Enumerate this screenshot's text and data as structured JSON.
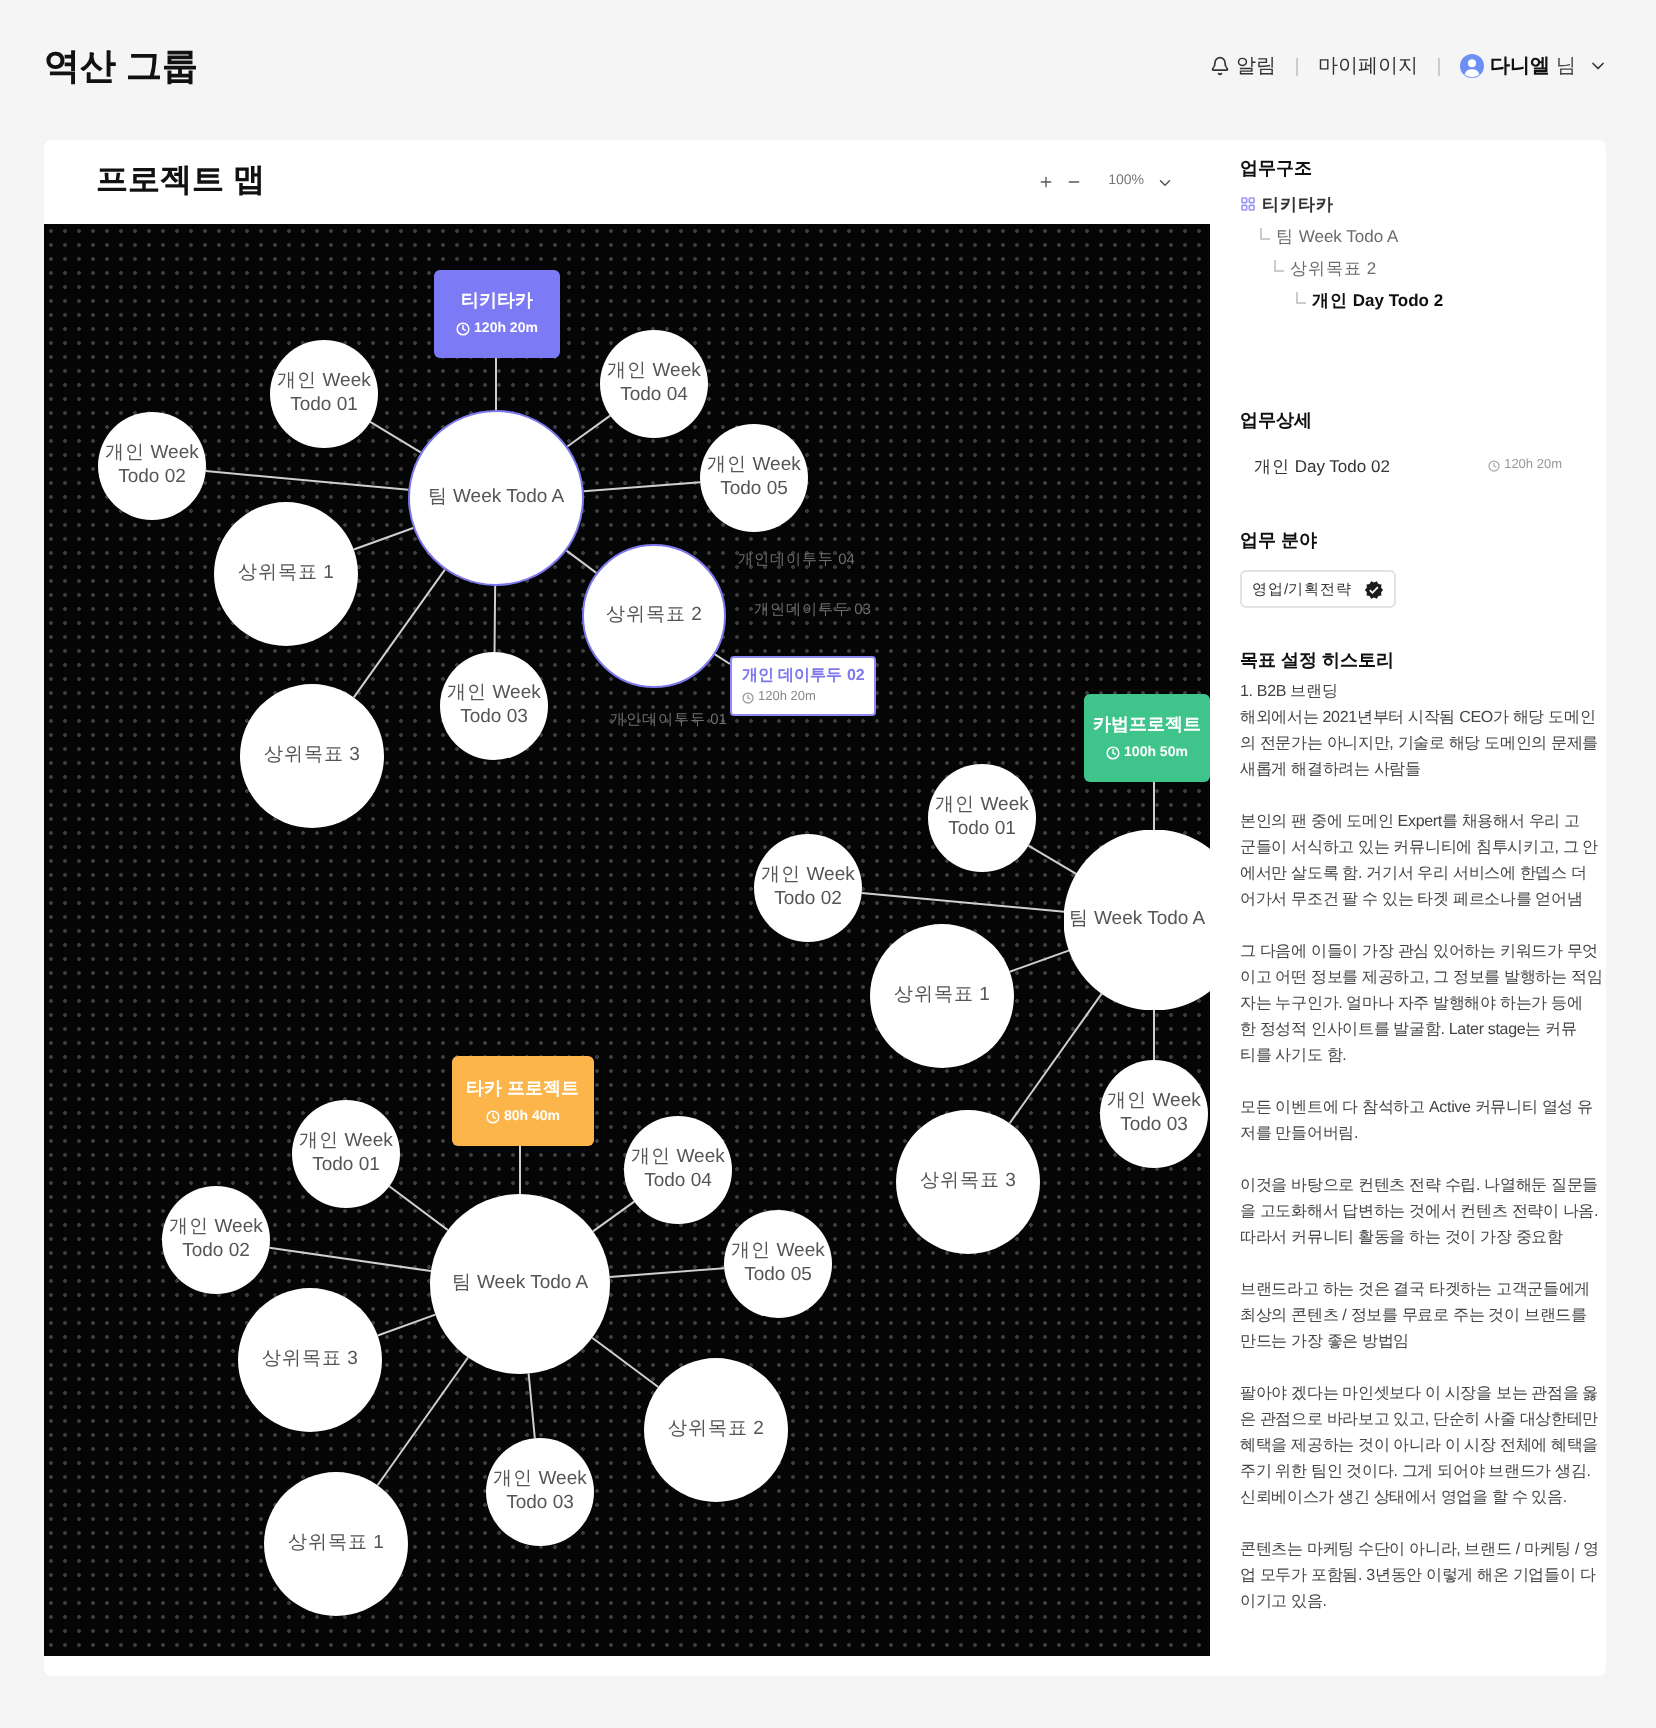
{
  "header": {
    "title": "역산 그룹",
    "notifications": "알림",
    "mypage": "마이페이지",
    "user": {
      "name": "다니엘",
      "suffix": "님"
    }
  },
  "map": {
    "title": "프로젝트 맵",
    "zoom": "100%",
    "projects": [
      {
        "name": "티키타카",
        "time": "120h 20m",
        "color": "#7d7af6",
        "team": {
          "label": "팀 Week Todo A",
          "selected": true
        },
        "nodes": [
          {
            "kind": "week",
            "label": "개인 Week Todo 01",
            "selected": false
          },
          {
            "kind": "week",
            "label": "개인 Week Todo 02",
            "selected": false
          },
          {
            "kind": "week",
            "label": "개인 Week Todo 03",
            "selected": false
          },
          {
            "kind": "week",
            "label": "개인 Week Todo 04",
            "selected": false
          },
          {
            "kind": "week",
            "label": "개인 Week Todo 05",
            "selected": false
          },
          {
            "kind": "goal",
            "label": "상위목표 1",
            "selected": false
          },
          {
            "kind": "goal",
            "label": "상위목표 2",
            "selected": true,
            "children": [
              {
                "label": "개인데이투두 04",
                "selected": false
              },
              {
                "label": "개인데이투두 03",
                "selected": false
              },
              {
                "label": "개인 데이투두 02",
                "time": "120h 20m",
                "selected": true
              },
              {
                "label": "개인데이투두 01",
                "selected": false
              }
            ]
          },
          {
            "kind": "goal",
            "label": "상위목표 3",
            "selected": false
          }
        ]
      },
      {
        "name": "카법프로젝트",
        "time": "100h 50m",
        "color": "#3fc48c",
        "team": {
          "label": "팀 Week Todo A",
          "selected": false
        },
        "nodes": [
          {
            "kind": "week",
            "label": "개인 Week Todo 01",
            "selected": false
          },
          {
            "kind": "week",
            "label": "개인 Week Todo 02",
            "selected": false
          },
          {
            "kind": "week",
            "label": "개인 Week Todo 03",
            "selected": false
          },
          {
            "kind": "goal",
            "label": "상위목표 1",
            "selected": false
          },
          {
            "kind": "goal",
            "label": "상위목표 3",
            "selected": false
          }
        ]
      },
      {
        "name": "타카 프로젝트",
        "time": "80h 40m",
        "color": "#fbb54a",
        "team": {
          "label": "팀 Week Todo A",
          "selected": false
        },
        "nodes": [
          {
            "kind": "week",
            "label": "개인 Week Todo 01",
            "selected": false
          },
          {
            "kind": "week",
            "label": "개인 Week Todo 02",
            "selected": false
          },
          {
            "kind": "week",
            "label": "개인 Week Todo 03",
            "selected": false
          },
          {
            "kind": "week",
            "label": "개인 Week Todo 04",
            "selected": false
          },
          {
            "kind": "week",
            "label": "개인 Week Todo 05",
            "selected": false
          },
          {
            "kind": "goal",
            "label": "상위목표 1",
            "selected": false
          },
          {
            "kind": "goal",
            "label": "상위목표 2",
            "selected": false
          },
          {
            "kind": "goal",
            "label": "상위목표 3",
            "selected": false
          }
        ]
      }
    ]
  },
  "panel": {
    "structure": {
      "title": "업무구조",
      "tree": [
        {
          "label": "티키타카",
          "selected": false,
          "children": [
            {
              "label": "팀 Week Todo A",
              "selected": false,
              "children": [
                {
                  "label": "상위목표 2",
                  "selected": false,
                  "children": [
                    {
                      "label": "개인 Day Todo 2",
                      "selected": true
                    }
                  ]
                }
              ]
            }
          ]
        }
      ]
    },
    "detail": {
      "title": "업무상세",
      "task": "개인 Day Todo 02",
      "time": "120h 20m"
    },
    "field": {
      "title": "업무 분야",
      "tag": "영업/기획전략"
    },
    "history": {
      "title": "목표 설정 히스토리",
      "paragraphs": [
        [
          "1. B2B 브랜딩",
          "해외에서는 2021년부터 시작됨 CEO가 해당 도메인",
          "의 전문가는 아니지만, 기술로 해당 도메인의 문제를",
          "새롭게 해결하려는 사람들"
        ],
        [
          "본인의 팬 중에 도메인 Expert를 채용해서 우리 고",
          "군들이 서식하고 있는 커뮤니티에 침투시키고, 그 안",
          "에서만 살도록 함. 거기서 우리 서비스에 한뎁스 더",
          "어가서 무조건 팔 수 있는 타겟 페르소나를 얻어냄"
        ],
        [
          "그 다음에 이들이 가장 관심 있어하는 키워드가 무엇",
          "이고 어떤 정보를 제공하고, 그 정보를 발행하는 적임",
          "자는 누구인가. 얼마나 자주 발행해야 하는가 등에",
          "한 정성적 인사이트를 발굴함. Later stage는 커뮤",
          "티를 사기도 함."
        ],
        [
          "모든 이벤트에 다 참석하고 Active 커뮤니티 열성 유",
          "저를 만들어버림."
        ],
        [
          "이것을 바탕으로 컨텐츠 전략 수립. 나열해둔 질문들",
          "을 고도화해서 답변하는 것에서 컨텐츠 전략이 나옴.",
          "따라서 커뮤니티 활동을 하는 것이 가장 중요함"
        ],
        [
          "브랜드라고 하는 것은 결국 타겟하는 고객군들에게",
          "최상의 콘텐츠 / 정보를 무료로 주는 것이 브랜드를",
          "만드는 가장 좋은 방법임"
        ],
        [
          "팔아야 겠다는 마인셋보다 이 시장을 보는 관점을 옳",
          "은 관점으로 바라보고 있고, 단순히 사줄 대상한테만",
          "혜택을 제공하는 것이 아니라 이 시장 전체에 혜택을",
          "주기 위한 팀인 것이다. 그게 되어야 브랜드가 생김.",
          "신뢰베이스가 생긴 상태에서 영업을 할 수 있음."
        ],
        [
          "콘텐츠는 마케팅 수단이 아니라, 브랜드 / 마케팅 / 영",
          "업 모두가 포함됨. 3년동안 이렇게 해온 기업들이 다",
          "이기고 있음."
        ]
      ]
    }
  }
}
